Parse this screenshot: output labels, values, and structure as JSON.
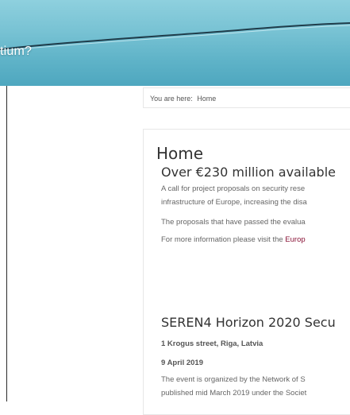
{
  "hero": {
    "title_fragment": "tium?"
  },
  "breadcrumb": {
    "prefix": "You are here:",
    "current": "Home"
  },
  "page": {
    "title": "Home"
  },
  "article": {
    "title": "Over €230 million available",
    "para1_line1": "A call for project proposals on security rese",
    "para1_line2": "infrastructure of Europe, increasing the disa",
    "para2": "The proposals that have passed the evalua",
    "para3_prefix": "For more information please visit the ",
    "para3_link": "Europ"
  },
  "event": {
    "title": "SEREN4 Horizon 2020 Secu",
    "location": "1 Krogus street, Riga, Latvia",
    "date": "9 April 2019",
    "desc_line1": "The event is organized by the Network of S",
    "desc_line2": "published mid March 2019 under the Societ"
  },
  "colors": {
    "link": "#8a1538",
    "hero_top": "#8ed0de",
    "hero_bottom": "#4ea7bf"
  }
}
